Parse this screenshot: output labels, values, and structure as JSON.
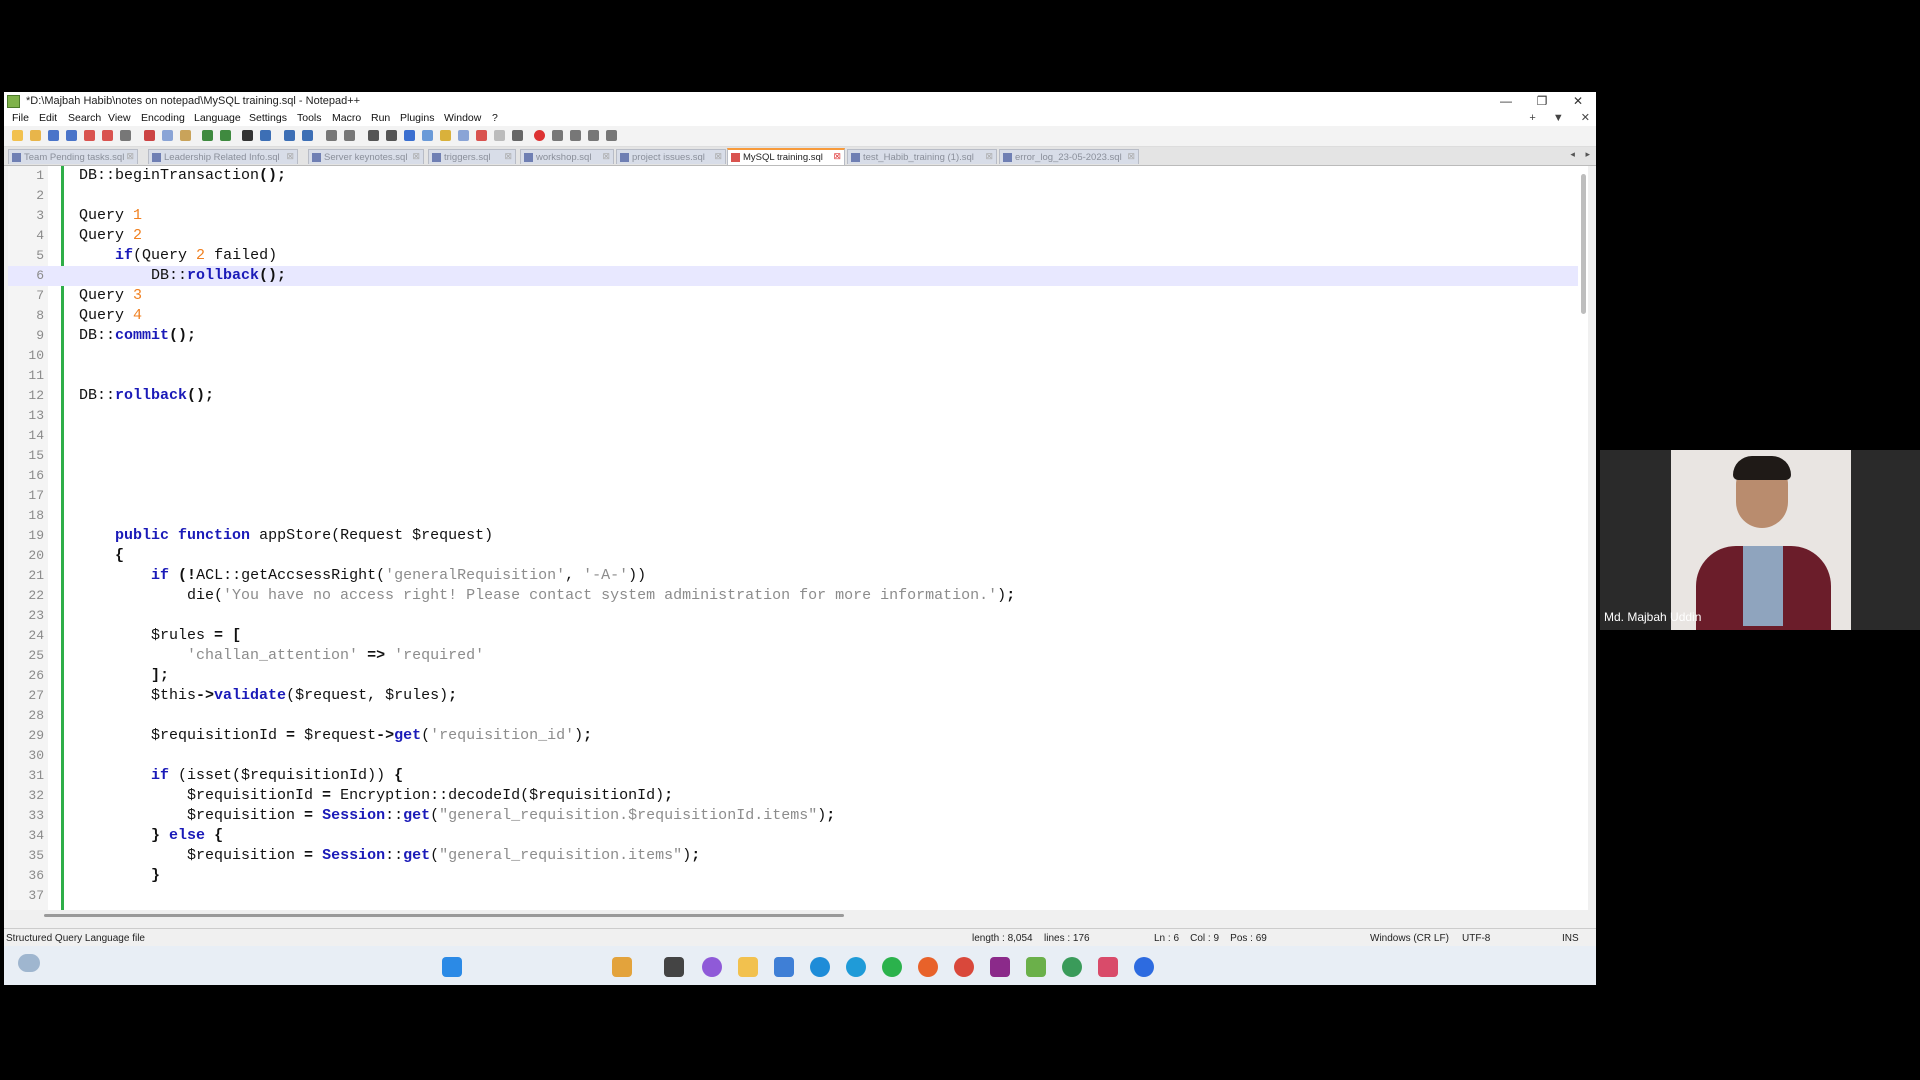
{
  "window": {
    "title": "*D:\\Majbah Habib\\notes on notepad\\MySQL training.sql - Notepad++",
    "controls": [
      "—",
      "❐",
      "✕"
    ]
  },
  "menu": [
    "File",
    "Edit",
    "Search",
    "View",
    "Encoding",
    "Language",
    "Settings",
    "Tools",
    "Macro",
    "Run",
    "Plugins",
    "Window",
    "?"
  ],
  "menu_right": [
    "+",
    "▼",
    "✕"
  ],
  "tabs": [
    {
      "label": "Team Pending tasks.sql"
    },
    {
      "label": "Leadership Related Info.sql"
    },
    {
      "label": "Server keynotes.sql"
    },
    {
      "label": "triggers.sql"
    },
    {
      "label": "workshop.sql"
    },
    {
      "label": "project issues.sql"
    },
    {
      "label": "MySQL training.sql",
      "active": true
    },
    {
      "label": "test_Habib_training (1).sql"
    },
    {
      "label": "error_log_23-05-2023.sql"
    }
  ],
  "tab_arrows": [
    "◂",
    "▸"
  ],
  "editor": {
    "lines": [
      {
        "n": "1",
        "html": "DB::beginTransaction<span class='op'>();</span>"
      },
      {
        "n": "2",
        "html": ""
      },
      {
        "n": "3",
        "html": "Query <span class='num'>1</span>"
      },
      {
        "n": "4",
        "html": "Query <span class='num'>2</span>"
      },
      {
        "n": "5",
        "html": "    <span class='kw'>if</span>(Query <span class='num'>2</span> failed)"
      },
      {
        "n": "6",
        "html": "        DB::<span class='kw'>rollback</span><span class='op'>();</span>",
        "current": true
      },
      {
        "n": "7",
        "html": "Query <span class='num'>3</span>"
      },
      {
        "n": "8",
        "html": "Query <span class='num'>4</span>"
      },
      {
        "n": "9",
        "html": "DB::<span class='kw'>commit</span><span class='op'>();</span>"
      },
      {
        "n": "10",
        "html": ""
      },
      {
        "n": "11",
        "html": ""
      },
      {
        "n": "12",
        "html": "DB::<span class='kw'>rollback</span><span class='op'>();</span>"
      },
      {
        "n": "13",
        "html": ""
      },
      {
        "n": "14",
        "html": ""
      },
      {
        "n": "15",
        "html": ""
      },
      {
        "n": "16",
        "html": ""
      },
      {
        "n": "17",
        "html": ""
      },
      {
        "n": "18",
        "html": ""
      },
      {
        "n": "19",
        "html": "    <span class='kw'>public</span> <span class='kw'>function</span> appStore(Request $request)"
      },
      {
        "n": "20",
        "html": "    <span class='op'>{</span>"
      },
      {
        "n": "21",
        "html": "        <span class='kw'>if</span> <span class='op'>(!</span>ACL::getAccsessRight(<span class='str'>'generalRequisition'</span>, <span class='str'>'-A-'</span>))"
      },
      {
        "n": "22",
        "html": "            die(<span class='str'>'You have no access right! Please contact system administration for more information.'</span>)<span class='op'>;</span>"
      },
      {
        "n": "23",
        "html": ""
      },
      {
        "n": "24",
        "html": "        $rules <span class='op'>=</span> <span class='op'>[</span>"
      },
      {
        "n": "25",
        "html": "            <span class='str'>'challan_attention'</span> <span class='op'>=&gt;</span> <span class='str'>'required'</span>"
      },
      {
        "n": "26",
        "html": "        <span class='op'>];</span>"
      },
      {
        "n": "27",
        "html": "        $this<span class='op'>-&gt;</span><span class='kw'>validate</span>($request, $rules)<span class='op'>;</span>"
      },
      {
        "n": "28",
        "html": ""
      },
      {
        "n": "29",
        "html": "        $requisitionId <span class='op'>=</span> $request<span class='op'>-&gt;</span><span class='kw'>get</span>(<span class='str'>'requisition_id'</span>)<span class='op'>;</span>"
      },
      {
        "n": "30",
        "html": ""
      },
      {
        "n": "31",
        "html": "        <span class='kw'>if</span> (isset($requisitionId)) <span class='op'>{</span>"
      },
      {
        "n": "32",
        "html": "            $requisitionId <span class='op'>=</span> Encryption::decodeId($requisitionId)<span class='op'>;</span>"
      },
      {
        "n": "33",
        "html": "            $requisition <span class='op'>=</span> <span class='kw'>Session</span>::<span class='kw'>get</span>(<span class='str'>\"general_requisition.$requisitionId.items\"</span>)<span class='op'>;</span>"
      },
      {
        "n": "34",
        "html": "        <span class='op'>}</span> <span class='kw'>else</span> <span class='op'>{</span>"
      },
      {
        "n": "35",
        "html": "            $requisition <span class='op'>=</span> <span class='kw'>Session</span>::<span class='kw'>get</span>(<span class='str'>\"general_requisition.items\"</span>)<span class='op'>;</span>"
      },
      {
        "n": "36",
        "html": "        <span class='op'>}</span>"
      },
      {
        "n": "37",
        "html": ""
      }
    ]
  },
  "status": {
    "filetype": "Structured Query Language file",
    "length": "length : 8,054",
    "lines": "lines : 176",
    "position": "Ln : 6    Col : 9    Pos : 69",
    "eol": "Windows (CR LF)",
    "encoding": "UTF-8",
    "mode": "INS"
  },
  "webcam": {
    "name": "Md. Majbah Uddin"
  },
  "colors": {
    "keyword": "#1a1ab8",
    "number": "#f08020",
    "string": "#8c8c8c",
    "current_line": "#e8e8ff",
    "active_tab_accent": "#f79a3b",
    "change_bar": "#2fae48"
  }
}
